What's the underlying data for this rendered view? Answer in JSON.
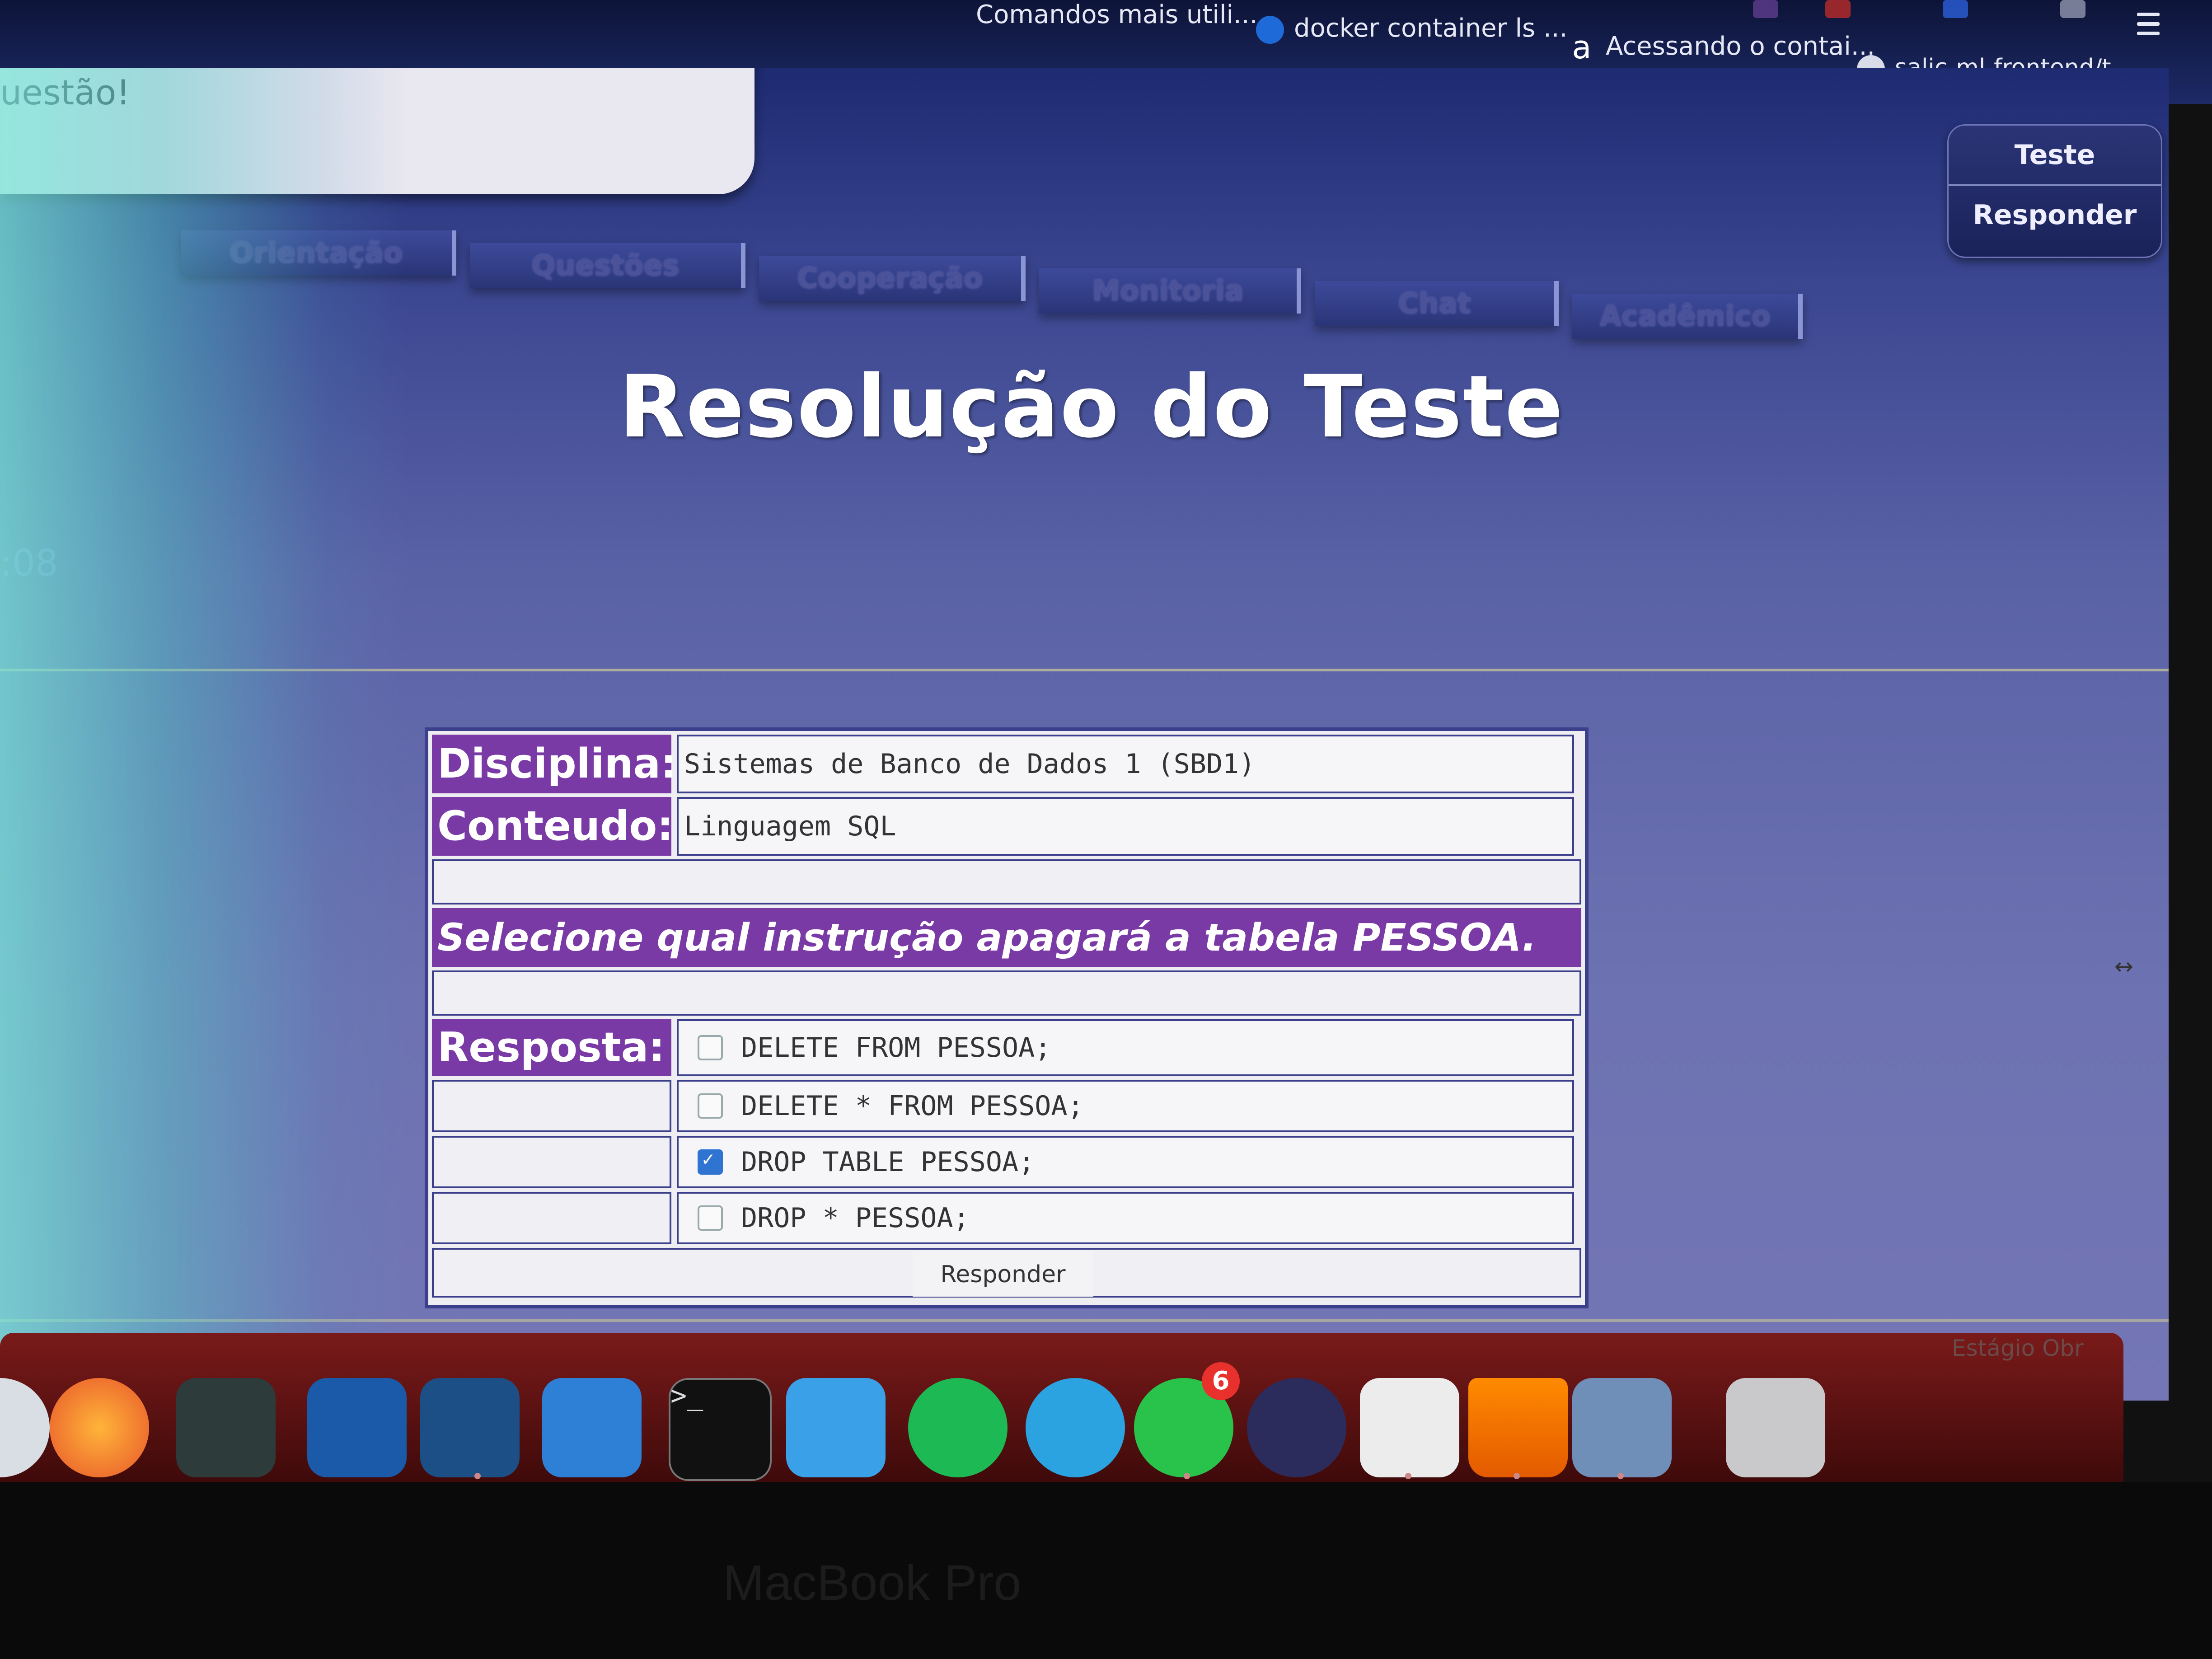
{
  "browser": {
    "bookmarks": [
      {
        "label": "Comandos mais utili...",
        "icon": "bookmark-icon"
      },
      {
        "label": "docker container ls ...",
        "icon": "docker-icon"
      },
      {
        "label": "Acessando o contai...",
        "icon": "amazon-icon"
      },
      {
        "label": "salic-ml-frontend/t...",
        "icon": "github-icon"
      }
    ],
    "more": "»"
  },
  "page": {
    "question_prompt": "uestão!",
    "timer": ":08",
    "side_buttons": [
      "Teste",
      "Responder"
    ],
    "tabs": [
      "Orientação",
      "Questões",
      "Cooperação",
      "Monitoria",
      "Chat",
      "Acadêmico"
    ],
    "title": "Resolução do Teste"
  },
  "question": {
    "discipline_label": "Disciplina:",
    "discipline_value": "Sistemas de Banco de Dados 1 (SBD1)",
    "content_label": "Conteudo:",
    "content_value": "Linguagem SQL",
    "statement": "Selecione qual instrução apagará a tabela PESSOA.",
    "answer_label": "Resposta:",
    "options": [
      {
        "text": "DELETE FROM PESSOA;",
        "checked": false
      },
      {
        "text": "DELETE * FROM PESSOA;",
        "checked": false
      },
      {
        "text": "DROP TABLE PESSOA;",
        "checked": true
      },
      {
        "text": "DROP * PESSOA;",
        "checked": false
      }
    ],
    "submit_label": "Responder"
  },
  "dock": {
    "apps": [
      "finder-icon",
      "firefox-icon",
      "app-icon",
      "vscode-icon",
      "mysql-workbench-icon",
      "xcode-icon",
      "terminal-icon",
      "docker-icon",
      "spotify-icon",
      "telegram-icon",
      "whatsapp-icon",
      "eclipse-icon",
      "java-icon",
      "vlc-icon",
      "preview-icon",
      "trash-icon"
    ],
    "whatsapp_badge": "6",
    "label": "Estágio Obr"
  },
  "device": {
    "label": "MacBook Pro"
  },
  "colors": {
    "label_purple": "#7a3aa6",
    "page_blue": "#5a62a6",
    "checkbox_blue": "#2f74d0",
    "dock_red": "#7a1a1a"
  }
}
